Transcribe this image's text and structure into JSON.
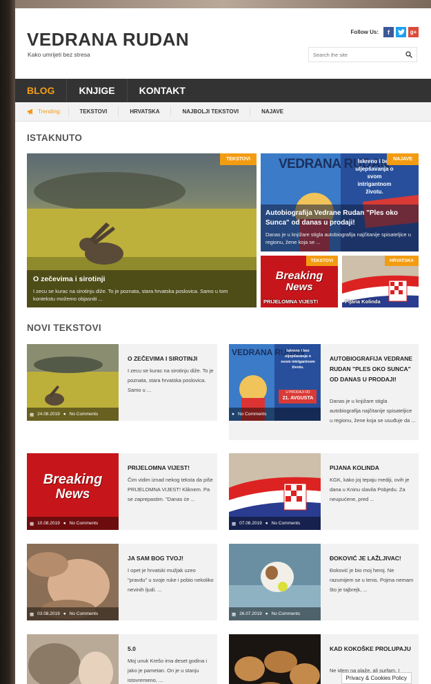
{
  "site": {
    "title": "VEDRANA RUDAN",
    "tagline": "Kako umrijeti bez stresa"
  },
  "follow": {
    "label": "Follow Us:",
    "icons": [
      "facebook-icon",
      "twitter-icon",
      "google-plus-icon"
    ]
  },
  "search": {
    "placeholder": "Search the site"
  },
  "nav": {
    "items": [
      "BLOG",
      "KNJIGE",
      "KONTAKT"
    ],
    "active": "BLOG"
  },
  "trending": {
    "label": "Trending:",
    "items": [
      "TEKSTOVI",
      "HRVATSKA",
      "NAJBOLJI TEKSTOVI",
      "NAJAVE"
    ]
  },
  "featured_section": {
    "title": "ISTAKNUTO"
  },
  "featured": [
    {
      "badge": "TEKSTOVI",
      "title": "O zečevima i sirotinji",
      "excerpt": "I zecu se kurac na sirotinju diže. To je poznata, stara hrvatska poslovica. Samo u tom kontekstu možemo objasniti ..."
    },
    {
      "badge": "NAJAVE",
      "title": "Autobiografija Vedrane Rudan \"Ples oko Sunca\" od danas u prodaji!",
      "excerpt": "Danas je u knjižare stigla autobiografija najčitanije spisateljice u regionu, žene koja se ..."
    },
    {
      "badge": "TEKSTOVI",
      "title": "PRIJELOMNA VIJEST!"
    },
    {
      "badge": "HRVATSKA",
      "title": "Pijana Kolinda"
    }
  ],
  "new_section": {
    "title": "NOVI TEKSTOVI"
  },
  "posts": [
    {
      "title": "O ZEČEVIMA I SIROTINJI",
      "excerpt": "I zecu se kurac na sirotinju diže. To je poznata, stara hrvatska poslovica. Samo u ...",
      "date": "24.08.2019",
      "comments": "No Comments"
    },
    {
      "title": "AUTOBIOGRAFIJA VEDRANE RUDAN \"PLES OKO SUNCA\" OD DANAS U PRODAJI!",
      "excerpt": "Danas je u knjižare stigla autobiografija najčitanije spisateljice u regionu, žene koja se usuđuje da ...",
      "date": "",
      "comments": "No Comments"
    },
    {
      "title": "PRIJELOMNA VIJEST!",
      "excerpt": "Čim vidim iznad nekog teksta da piše PRIJELOMNA VIJEST! Kliknem. Pa se zaprepastim. \"Danas će ...",
      "date": "10.08.2019",
      "comments": "No Comments"
    },
    {
      "title": "PIJANA KOLINDA",
      "excerpt": "KGK, kako joj tepaju mediji, ovih je dana u Kninu slavila Pobjedu. Za neupućene, pred ...",
      "date": "07.08.2019",
      "comments": "No Comments"
    },
    {
      "title": "JA SAM BOG TVOJ!",
      "excerpt": "I opet je hrvatski mužjak uzeo \"pravdu\" u svoje ruke i pobio nekoliko nevinih ljudi. ...",
      "date": "03.08.2019",
      "comments": "No Comments"
    },
    {
      "title": "ĐOKOVIĆ JE LAŽLJIVAC!",
      "excerpt": "Đoković je bio moj heroj. Ne razumijem se u tenis. Pojma nemam što je tajbrejk, ...",
      "date": "26.07.2019",
      "comments": "No Comments"
    },
    {
      "title": "5.0",
      "excerpt": "Moj unuk Krešo ima deset godina i jako je pametan. On je u stanju istovremeno, ...",
      "date": "",
      "comments": ""
    },
    {
      "title": "KAD KOKOŠKE PROLUPAJU",
      "excerpt": "Ne idem na plaže, ali surfam. I",
      "date": "",
      "comments": ""
    }
  ],
  "book_cover": {
    "author": "VEDRANA RUDAN",
    "blurb": "Iskreno i bez uljepšavanja o svom intrigantnom životu.",
    "release": "U PRODAJI OD",
    "date": "21. AVGUSTA"
  },
  "breaking": {
    "line1": "Breaking",
    "line2": "News"
  },
  "privacy": {
    "label": "Privacy & Cookies Policy"
  },
  "colors": {
    "accent": "#f39c12",
    "nav_bg": "#333333",
    "card_bg": "#f2f2f2"
  }
}
